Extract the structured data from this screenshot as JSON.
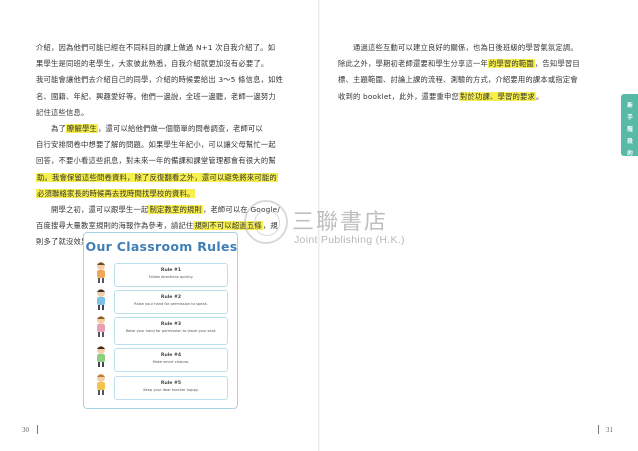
{
  "left_page": {
    "paragraphs": [
      [
        {
          "t": "介紹，因為他們可能已經在不同科目的課上做過 N+1 次自我介紹了。如",
          "hl": false
        },
        {
          "t": "果學生是同班的老學生，大家彼此熟悉，自我介紹就更加沒有必要了。",
          "hl": false
        },
        {
          "t": "我可能會讓他們去介紹自己的同學，介紹的時候要給出 3～5 條信息，如姓",
          "hl": false
        },
        {
          "t": "名、國籍、年紀、興趣愛好等。他們一邊說，全班一邊聽，老師一邊努力",
          "hl": false
        },
        {
          "t": "記住這些信息。",
          "hl": false
        }
      ],
      [
        {
          "t": "　　為了瞭解學生",
          "hl": false,
          "mark": "瞭解學生"
        },
        {
          "t": "自行安排問卷中想要了解的問題。如果學生年紀小，可以讓父母幫忙一起",
          "hl": false
        },
        {
          "t": "回答，不要小看這些訊息，對未來一年的備課和課堂管理都會有很大的幫",
          "hl": false
        },
        {
          "t": "助。我會保留這些問卷資料，除了反復翻看之外，還可以避免將來可能的",
          "hl": true
        },
        {
          "t": "必須聯絡家長的時候再去找時間找學校的資料。",
          "hl": true
        }
      ],
      [
        {
          "t": "　　開學之初，還可以跟學生一起制定教室的規則，老師可以在 Google/",
          "hl": false
        },
        {
          "t": "百度搜尋大量教室規則的海報作為參考，請記住規則不可以超過五條，規",
          "hl": false
        },
        {
          "t": "則多了就沒效果了。",
          "hl": false
        }
      ]
    ],
    "para2_line1_rest": "，還可以給他們做一個簡單的問卷調查，老師可以",
    "para3_line1_mark": "制定教室的規則",
    "para3_line2_mark": "規則不可以超過五條"
  },
  "poster": {
    "title": "Our Classroom Rules",
    "rules": [
      {
        "num": "Rule #1",
        "text": "Follow directions quickly."
      },
      {
        "num": "Rule #2",
        "text": "Raise your hand for permission to speak."
      },
      {
        "num": "Rule #3",
        "text": "Raise your hand for permission to leave your seat."
      },
      {
        "num": "Rule #4",
        "text": "Make smart choices."
      },
      {
        "num": "Rule #5",
        "text": "Keep your dear teacher happy."
      }
    ],
    "kid_colors": [
      "#f0a65a",
      "#7cc2e8",
      "#e9a0b6",
      "#8ccf7e",
      "#f2c44f"
    ]
  },
  "right_page": {
    "lines": [
      "　　通過這些互動可以建立良好的關係，也為日後班級的學習氣氛定調。",
      "除此之外，學期初老師還要和學生分享這一年",
      "標、主題範圍、討論上課的流程、測驗的方式，介紹要用的課本或指定會",
      "收到的 booklet，此外，還要重申您",
      "。"
    ],
    "line2_mark": "的學習的範圍",
    "line2_rest": "，告知學習目",
    "line4_mark": "對於功課、學習的要求",
    "side_tab": [
      "新",
      "手",
      "階",
      "段",
      "的"
    ]
  },
  "watermark": {
    "cn": "三聯書店",
    "en": "Joint Publishing (H.K.)"
  },
  "page_numbers": {
    "left": "30",
    "right": "31"
  },
  "colors": {
    "highlight": "#f6ef4f",
    "tab": "#58b9a6",
    "poster_title": "#3f7fb6"
  }
}
